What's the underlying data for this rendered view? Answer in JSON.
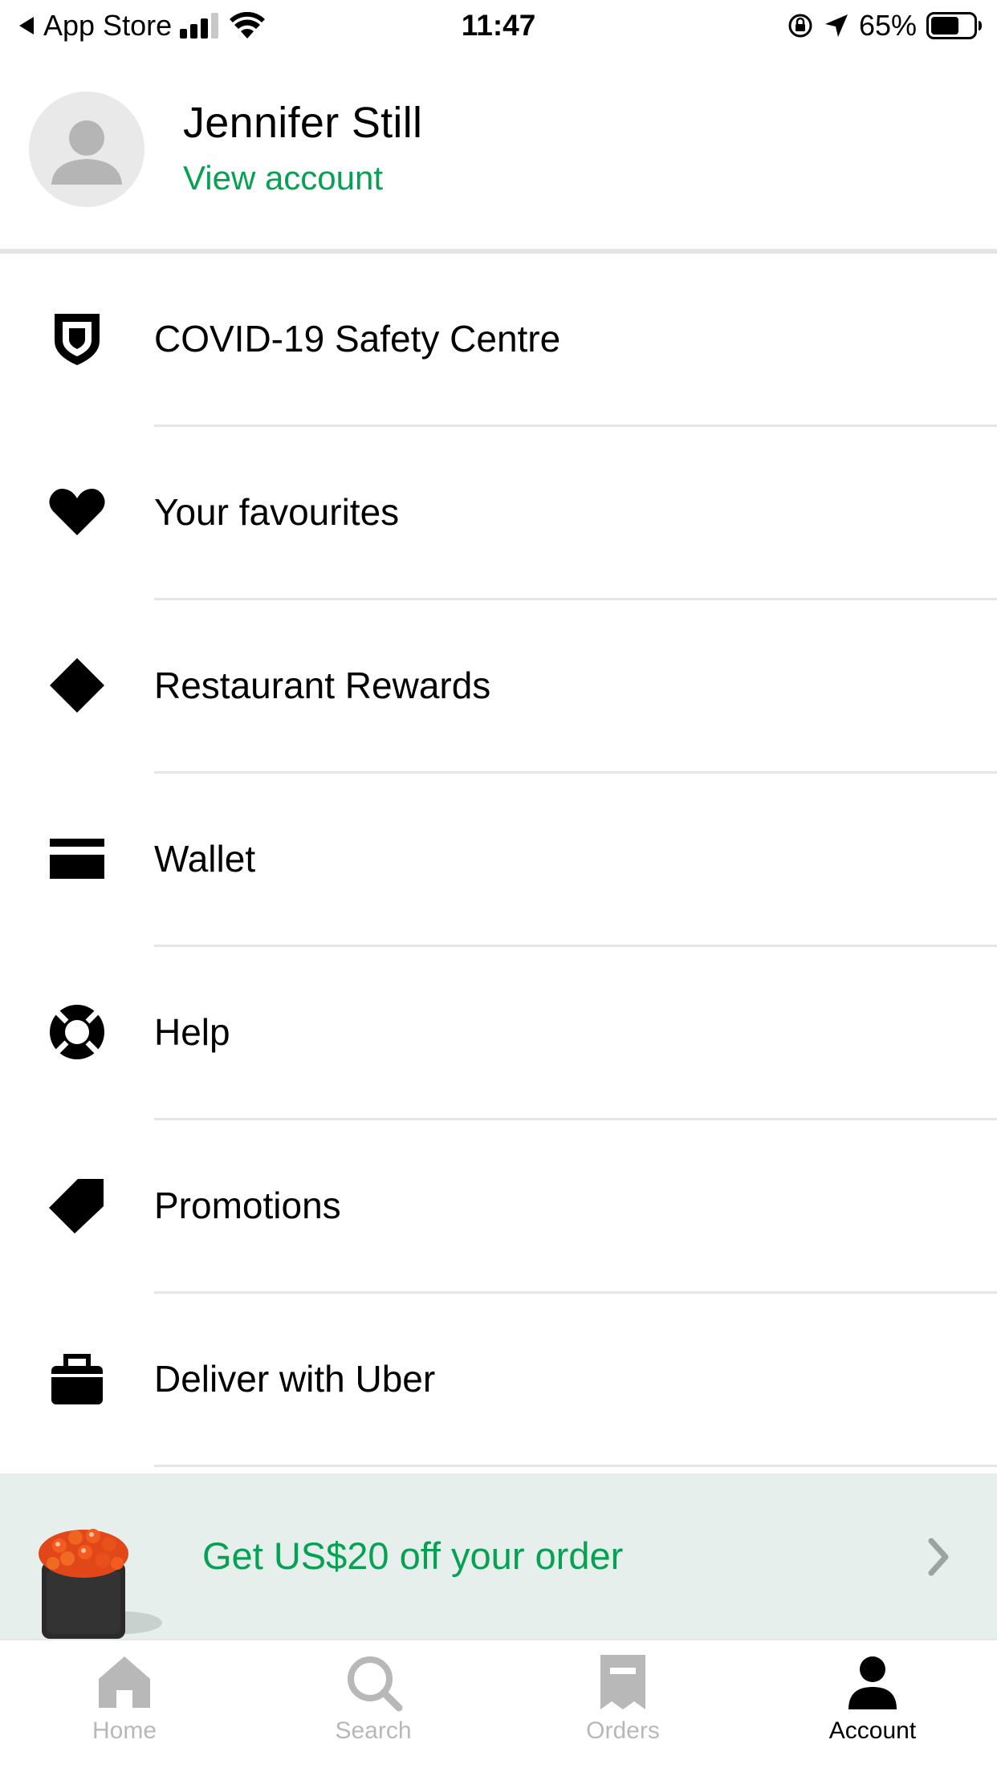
{
  "status_bar": {
    "back_app": "App Store",
    "time": "11:47",
    "battery": "65%"
  },
  "profile": {
    "name": "Jennifer Still",
    "view_account": "View account"
  },
  "menu": {
    "items": [
      {
        "label": "COVID-19 Safety Centre",
        "icon": "shield-icon"
      },
      {
        "label": "Your favourites",
        "icon": "heart-icon"
      },
      {
        "label": "Restaurant Rewards",
        "icon": "diamond-icon"
      },
      {
        "label": "Wallet",
        "icon": "wallet-icon"
      },
      {
        "label": "Help",
        "icon": "lifebuoy-icon"
      },
      {
        "label": "Promotions",
        "icon": "tag-icon"
      },
      {
        "label": "Deliver with Uber",
        "icon": "bag-icon"
      }
    ]
  },
  "promo": {
    "text": "Get US$20 off your order"
  },
  "tabbar": {
    "tabs": [
      {
        "label": "Home",
        "icon": "home-icon"
      },
      {
        "label": "Search",
        "icon": "search-icon"
      },
      {
        "label": "Orders",
        "icon": "receipt-icon"
      },
      {
        "label": "Account",
        "icon": "person-icon"
      }
    ],
    "active": "Account"
  },
  "colors": {
    "accent_green": "#06a153",
    "promo_bg": "#e6efec",
    "inactive_tab": "#b8b8b8"
  }
}
